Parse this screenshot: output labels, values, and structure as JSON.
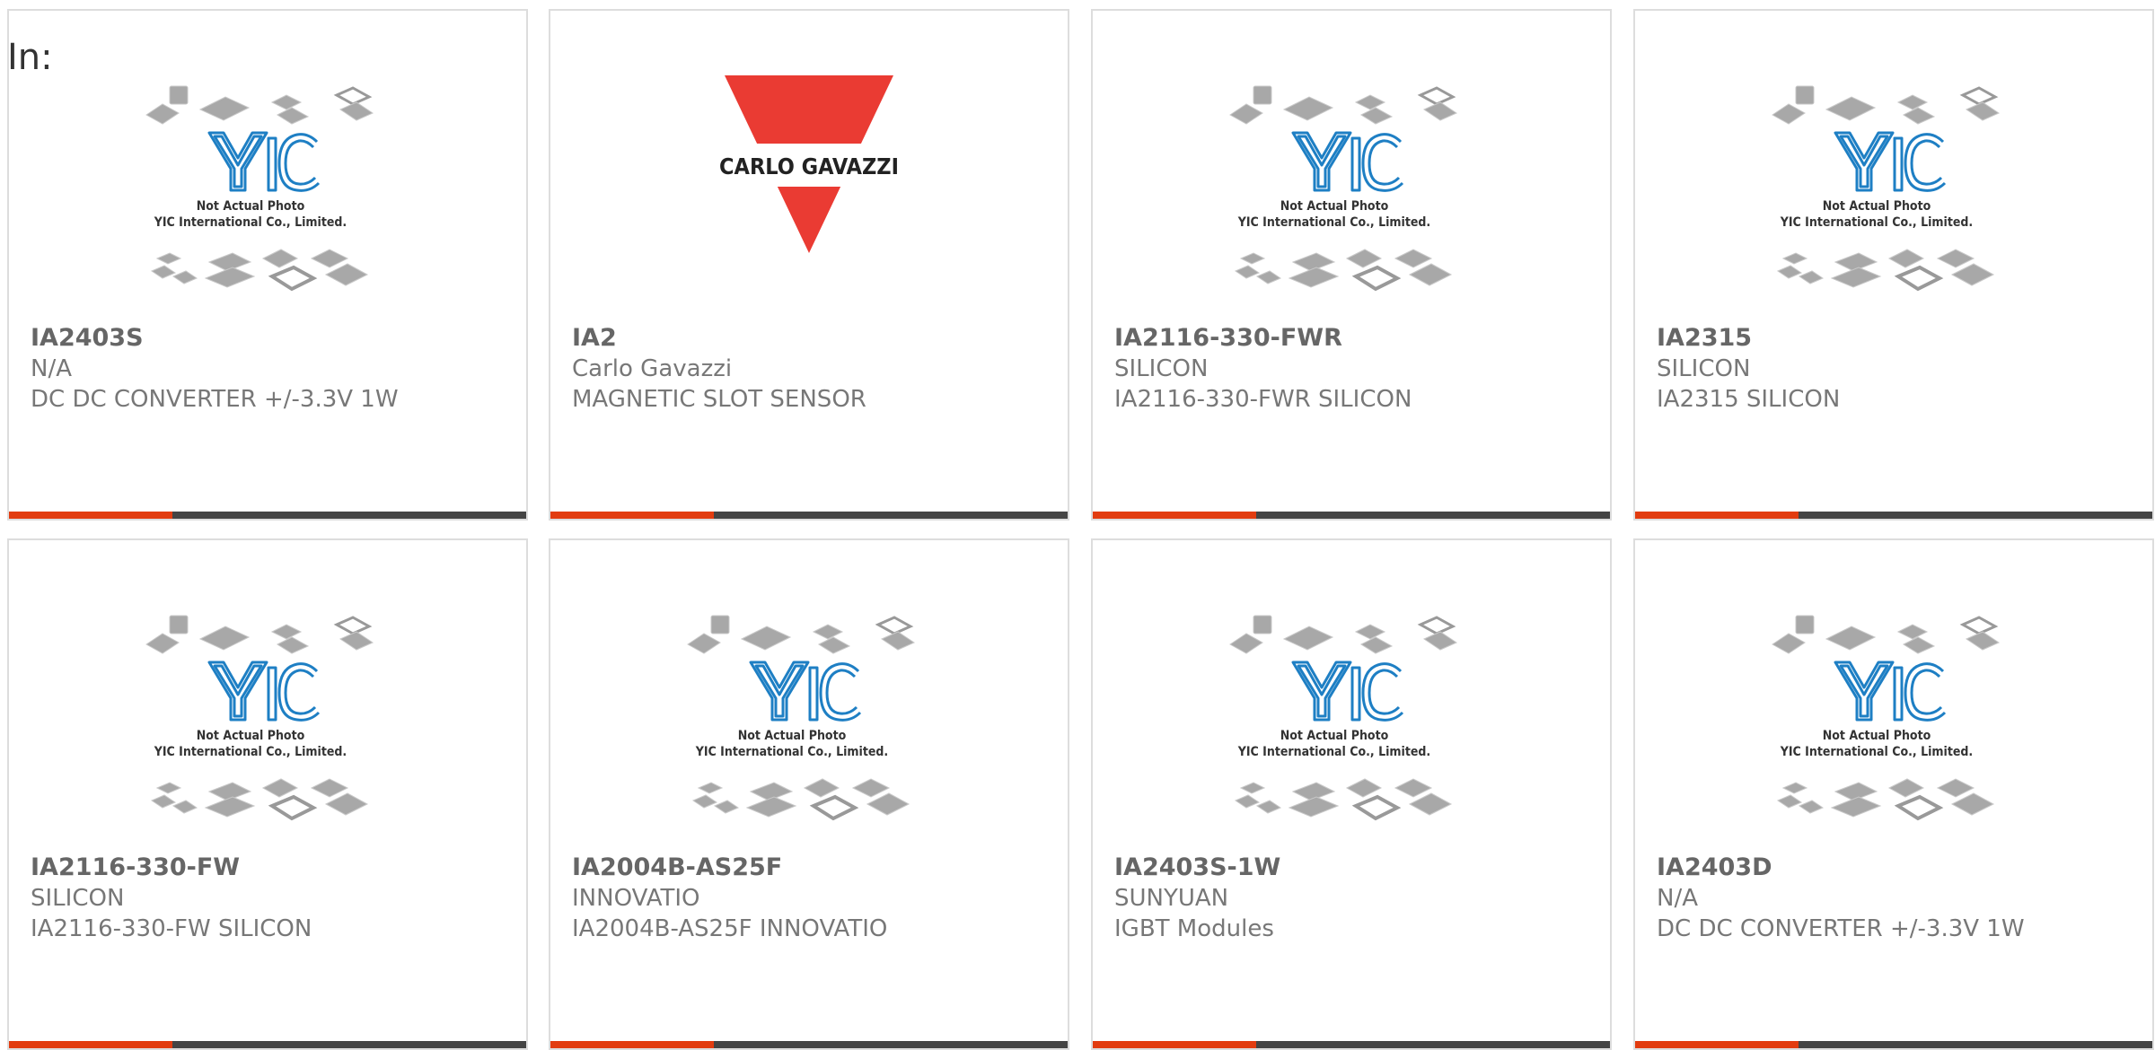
{
  "filter": {
    "label": "In:"
  },
  "colors": {
    "accent": "#e23c10",
    "bar": "#444444",
    "logo_blue": "#1e7fc4",
    "carlo_red": "#ea3b33"
  },
  "placeholder_image": {
    "line1": "Not Actual Photo",
    "line2": "YIC International Co., Limited."
  },
  "products": [
    {
      "part": "IA2403S",
      "brand": "N/A",
      "desc": "DC DC CONVERTER +/-3.3V 1W",
      "image": "placeholder"
    },
    {
      "part": "IA2",
      "brand": "Carlo Gavazzi",
      "desc": "MAGNETIC SLOT SENSOR",
      "image": "carlo",
      "image_text": "CARLO GAVAZZI"
    },
    {
      "part": "IA2116-330-FWR",
      "brand": "SILICON",
      "desc": "IA2116-330-FWR SILICON",
      "image": "placeholder"
    },
    {
      "part": "IA2315",
      "brand": "SILICON",
      "desc": "IA2315 SILICON",
      "image": "placeholder"
    },
    {
      "part": "IA2116-330-FW",
      "brand": "SILICON",
      "desc": "IA2116-330-FW SILICON",
      "image": "placeholder"
    },
    {
      "part": "IA2004B-AS25F",
      "brand": "INNOVATIO",
      "desc": "IA2004B-AS25F INNOVATIO",
      "image": "placeholder"
    },
    {
      "part": "IA2403S-1W",
      "brand": "SUNYUAN",
      "desc": "IGBT Modules",
      "image": "placeholder"
    },
    {
      "part": "IA2403D",
      "brand": "N/A",
      "desc": "DC DC CONVERTER +/-3.3V 1W",
      "image": "placeholder"
    }
  ]
}
